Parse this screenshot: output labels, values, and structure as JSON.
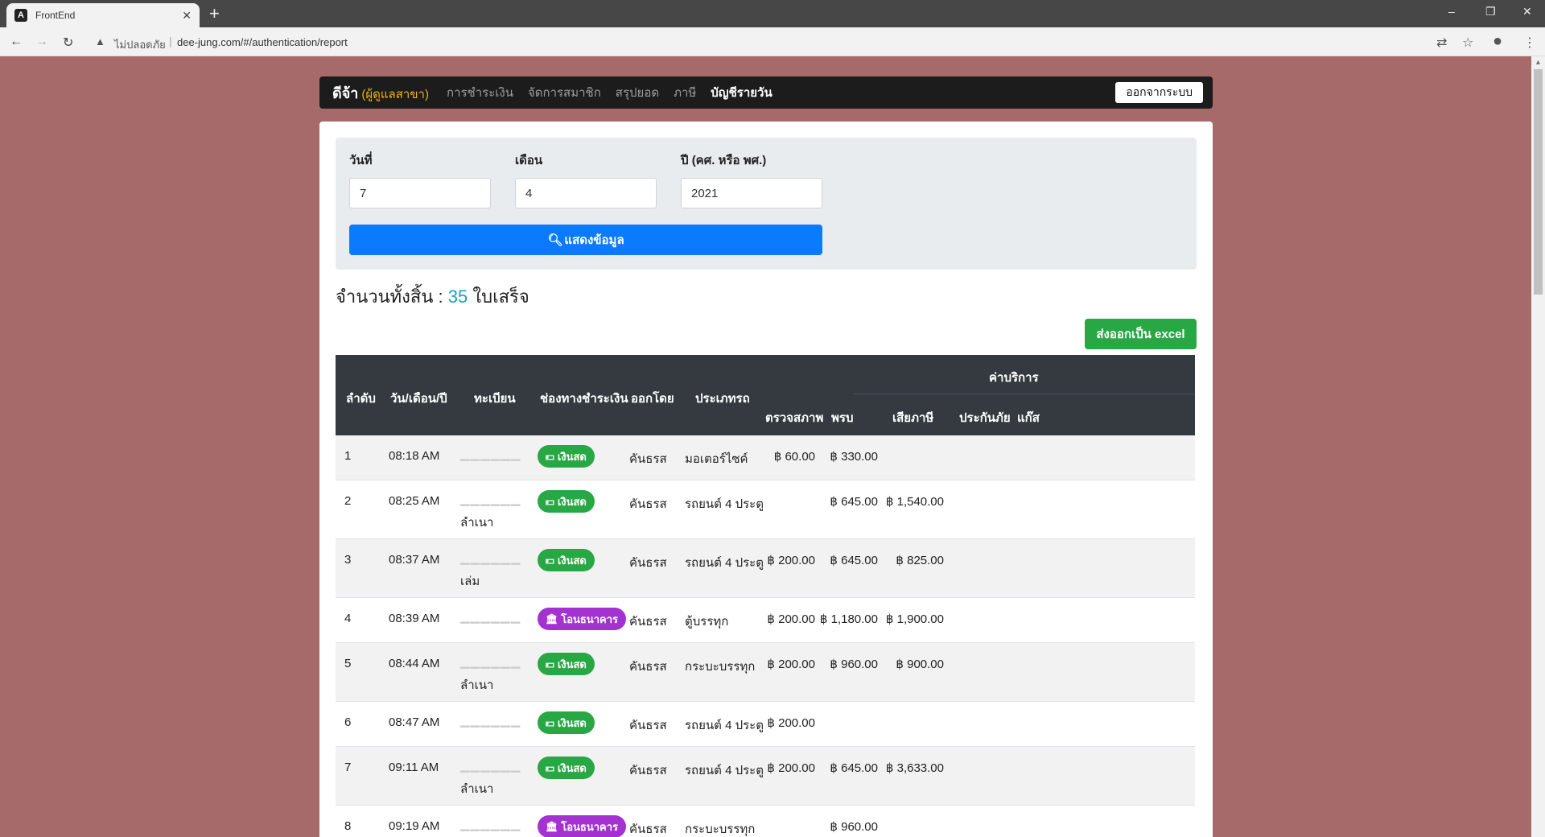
{
  "browser": {
    "tab_title": "FrontEnd",
    "insecure_label": "ไม่ปลอดภัย",
    "url": "dee-jung.com/#/authentication/report"
  },
  "nav": {
    "brand": "ดีจ้า",
    "role": "(ผู้ดูแลสาขา)",
    "links": [
      "การชำระเงิน",
      "จัดการสมาชิก",
      "สรุปยอด",
      "ภาษี",
      "บัญชีรายวัน"
    ],
    "logout": "ออกจากระบบ"
  },
  "form": {
    "day_label": "วันที่",
    "day_value": "7",
    "month_label": "เดือน",
    "month_value": "4",
    "year_label": "ปี (คศ. หรือ พศ.)",
    "year_value": "2021",
    "show_button": "แสดงข้อมูล"
  },
  "summary": {
    "prefix": "จำนวนทั้งสิ้น :",
    "count": "35",
    "suffix": "ใบเสร็จ"
  },
  "export_button": "ส่งออกเป็น excel",
  "table": {
    "headers": {
      "no": "ลำดับ",
      "date": "วัน/เดือน/ปี",
      "plate": "ทะเบียน",
      "channel": "ช่องทางชำระเงิน",
      "issuer": "ออกโดย",
      "type": "ประเภทรถ",
      "fees": "ค่าบริการ",
      "inspection": "ตรวจสภาพ",
      "prb": "พรบ",
      "tax": "เสียภาษี",
      "insurance": "ประกันภัย",
      "gas": "แก๊ส"
    },
    "rows": [
      {
        "no": "1",
        "time": "08:18 AM",
        "plate": "",
        "plate2": "",
        "channel": "เงินสด",
        "kind": "cash",
        "issuer": "คันธรส",
        "type": "มอเตอร์ไซค์",
        "inspection": "฿ 60.00",
        "prb": "฿ 330.00",
        "tax": ""
      },
      {
        "no": "2",
        "time": "08:25 AM",
        "plate": "",
        "plate2": "ลำเนา",
        "channel": "เงินสด",
        "kind": "cash",
        "issuer": "คันธรส",
        "type": "รถยนต์ 4 ประตู",
        "inspection": "",
        "prb": "฿ 645.00",
        "tax": "฿ 1,540.00"
      },
      {
        "no": "3",
        "time": "08:37 AM",
        "plate": "",
        "plate2": "เล่ม",
        "channel": "เงินสด",
        "kind": "cash",
        "issuer": "คันธรส",
        "type": "รถยนต์ 4 ประตู",
        "inspection": "฿ 200.00",
        "prb": "฿ 645.00",
        "tax": "฿ 825.00"
      },
      {
        "no": "4",
        "time": "08:39 AM",
        "plate": "",
        "plate2": "",
        "channel": "โอนธนาคาร",
        "kind": "bank",
        "issuer": "คันธรส",
        "type": "ตู้บรรทุก",
        "inspection": "฿ 200.00",
        "prb": "฿ 1,180.00",
        "tax": "฿ 1,900.00"
      },
      {
        "no": "5",
        "time": "08:44 AM",
        "plate": "",
        "plate2": "ลำเนา",
        "channel": "เงินสด",
        "kind": "cash",
        "issuer": "คันธรส",
        "type": "กระบะบรรทุก",
        "inspection": "฿ 200.00",
        "prb": "฿ 960.00",
        "tax": "฿ 900.00"
      },
      {
        "no": "6",
        "time": "08:47 AM",
        "plate": "",
        "plate2": "",
        "channel": "เงินสด",
        "kind": "cash",
        "issuer": "คันธรส",
        "type": "รถยนต์ 4 ประตู",
        "inspection": "฿ 200.00",
        "prb": "",
        "tax": ""
      },
      {
        "no": "7",
        "time": "09:11 AM",
        "plate": "",
        "plate2": "ลำเนา",
        "channel": "เงินสด",
        "kind": "cash",
        "issuer": "คันธรส",
        "type": "รถยนต์ 4 ประตู",
        "inspection": "฿ 200.00",
        "prb": "฿ 645.00",
        "tax": "฿ 3,633.00"
      },
      {
        "no": "8",
        "time": "09:19 AM",
        "plate": "",
        "plate2": "",
        "channel": "โอนธนาคาร",
        "kind": "bank",
        "issuer": "คันธรส",
        "type": "กระบะบรรทุก",
        "inspection": "",
        "prb": "฿ 960.00",
        "tax": ""
      }
    ]
  }
}
